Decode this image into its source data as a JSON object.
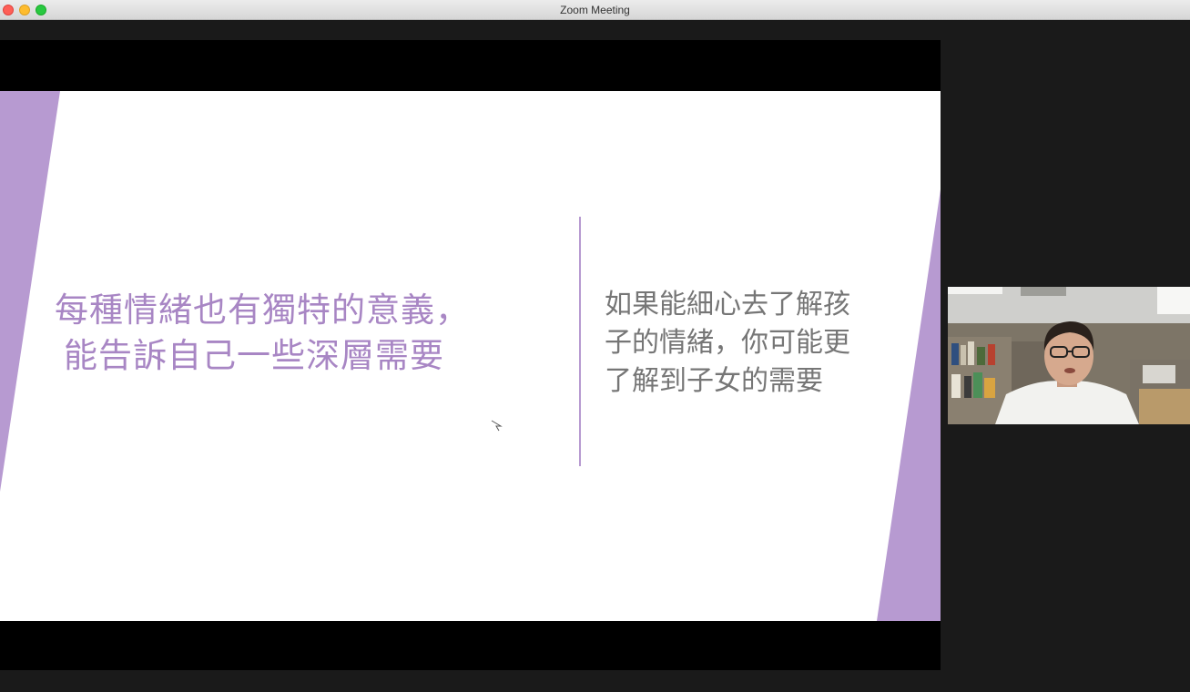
{
  "window": {
    "title": "Zoom Meeting"
  },
  "slide": {
    "left_text": {
      "line1": "每種情緒也有獨特的意義，",
      "line2": "能告訴自己一些深層需要"
    },
    "right_text": {
      "line1": "如果能細心去了解孩",
      "line2": "子的情緒，你可能更",
      "line3": "了解到子女的需要"
    },
    "colors": {
      "accent_purple": "#b79ad1",
      "left_text": "#a886c4",
      "right_text": "#767676"
    }
  },
  "participant_video": {
    "description_icon": "participant-video"
  }
}
